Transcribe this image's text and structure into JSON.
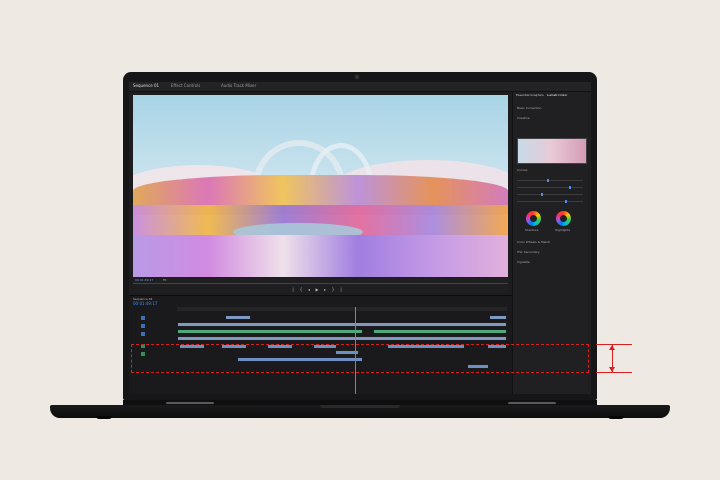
{
  "app": {
    "tabs": [
      "Sequence 01",
      "Effect Controls",
      "Audio Track Mixer"
    ],
    "panel_tabs": [
      "Essential Graphics",
      "Lumetri Color"
    ],
    "panel_rows": [
      "Basic Correction",
      "Creative",
      "Curves",
      "Color Wheels & Match",
      "HSL Secondary",
      "Vignette"
    ],
    "panel_labels": [
      "Shadows",
      "Highlights",
      "Midtones"
    ],
    "timeline_name": "Sequence 01",
    "timecode": "00:01:49:17",
    "monitor_timecode": "00:01:49:17",
    "monitor_fit": "Fit",
    "accent": "#4e8cf0",
    "annotation_color": "#d92020"
  }
}
